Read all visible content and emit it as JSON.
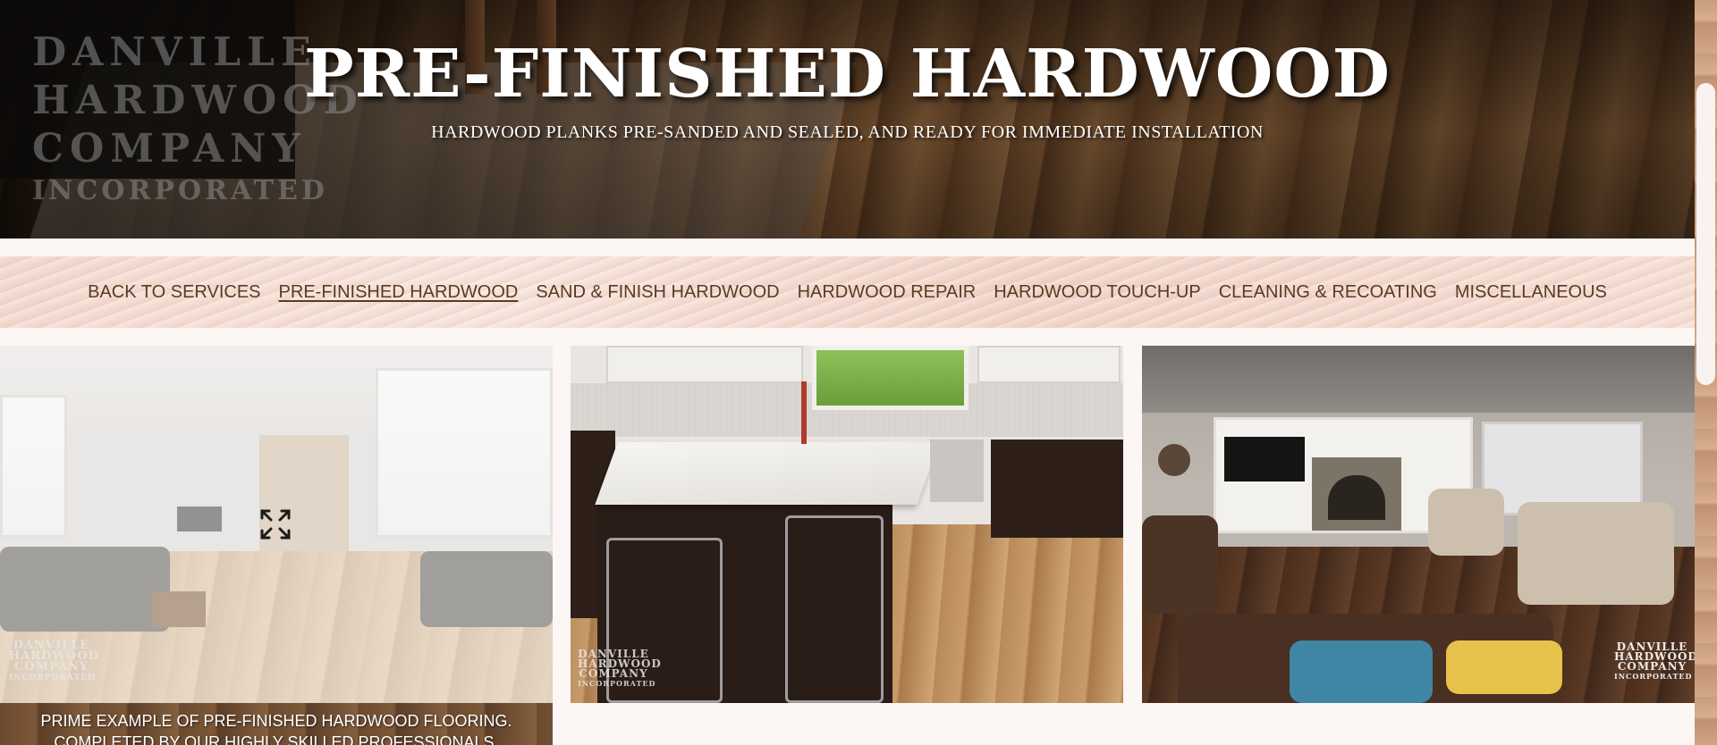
{
  "hero": {
    "title": "PRE-FINISHED HARDWOOD",
    "subtitle": "HARDWOOD PLANKS PRE-SANDED AND SEALED, AND READY FOR IMMEDIATE INSTALLATION",
    "logo_lines": [
      "DANVILLE",
      "HARDWOOD",
      "COMPANY",
      "INCORPORATED"
    ]
  },
  "nav": {
    "items": [
      {
        "label": "BACK TO SERVICES",
        "active": false
      },
      {
        "label": "PRE-FINISHED HARDWOOD",
        "active": true
      },
      {
        "label": "SAND & FINISH HARDWOOD",
        "active": false
      },
      {
        "label": "HARDWOOD REPAIR",
        "active": false
      },
      {
        "label": "HARDWOOD TOUCH-UP",
        "active": false
      },
      {
        "label": "CLEANING & RECOATING",
        "active": false
      },
      {
        "label": "MISCELLANEOUS",
        "active": false
      }
    ]
  },
  "gallery": {
    "watermark_lines": [
      "DANVILLE",
      "HARDWOOD",
      "COMPANY",
      "INCORPORATED"
    ],
    "caption": {
      "line1": "PRIME EXAMPLE OF PRE-FINISHED HARDWOOD FLOORING.",
      "line2": "COMPLETED BY OUR HIGHLY SKILLED PROFESSIONALS."
    },
    "expand_icon": "expand-arrows-icon"
  },
  "colors": {
    "nav_text": "#5a3b22",
    "page_bg": "#fcf6f5"
  }
}
